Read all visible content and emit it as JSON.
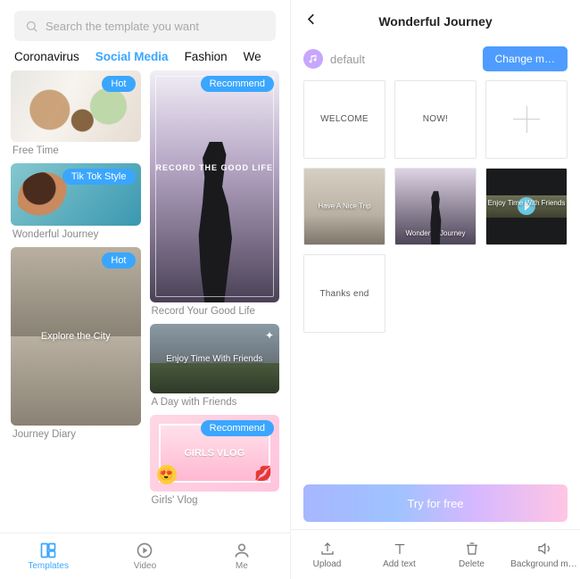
{
  "left": {
    "search_placeholder": "Search the template you want",
    "categories": [
      {
        "label": "Coronavirus",
        "active": false
      },
      {
        "label": "Social Media",
        "active": true
      },
      {
        "label": "Fashion",
        "active": false
      },
      {
        "label": "We",
        "active": false
      }
    ],
    "col1": [
      {
        "title": "Free Time",
        "badge": "Hot",
        "thumb": "freetime"
      },
      {
        "title": "Wonderful Journey",
        "badge": "Tik Tok Style",
        "thumb": "tiktok"
      },
      {
        "title": "Journey Diary",
        "badge": "Hot",
        "thumb": "journey",
        "overlay": "Explore the City"
      }
    ],
    "col2": [
      {
        "title": "Record Your Good Life",
        "badge": "Recommend",
        "thumb": "record",
        "overlay": "RECORD THE GOOD LIFE"
      },
      {
        "title": "A Day with Friends",
        "badge": "",
        "thumb": "friends",
        "overlay": "Enjoy Time With Friends"
      },
      {
        "title": "Girls' Vlog",
        "badge": "Recommend",
        "thumb": "girls",
        "overlay": "GIRLS VLOG"
      }
    ],
    "nav": {
      "templates": "Templates",
      "video": "Video",
      "me": "Me"
    }
  },
  "right": {
    "title": "Wonderful Journey",
    "music": "default",
    "change": "Change m…",
    "slides": {
      "welcome": "WELCOME",
      "now": "NOW!",
      "thanks": "Thanks end",
      "img1_cap": "Have A Nice Trip",
      "img2_cap": "Wonderful Journey",
      "img3_cap": "Enjoy Time With Friends"
    },
    "try": "Try for free",
    "tools": {
      "upload": "Upload",
      "addtext": "Add text",
      "delete": "Delete",
      "bgmusic": "Background m…"
    }
  }
}
